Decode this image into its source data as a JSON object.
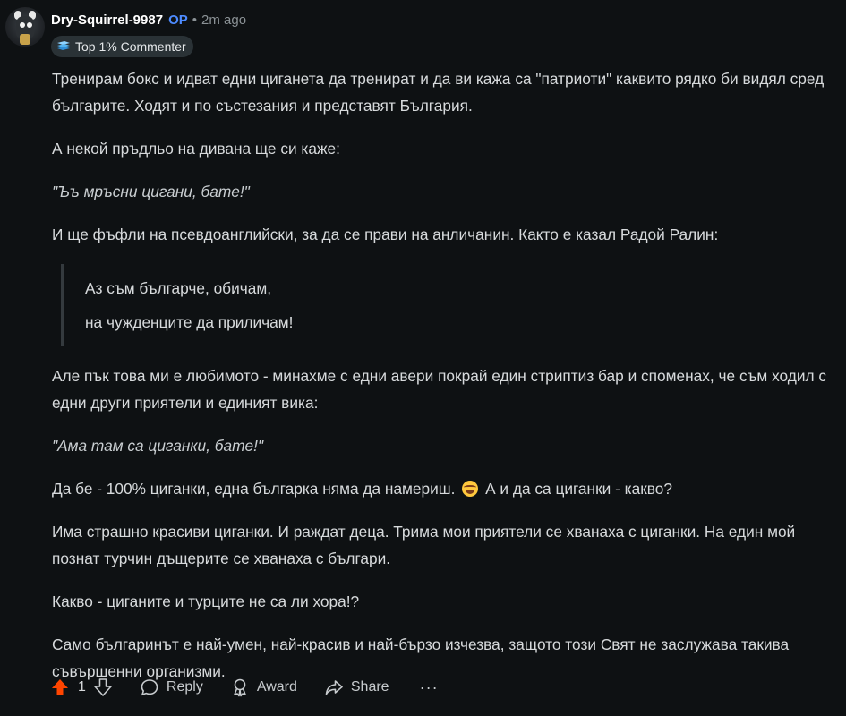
{
  "comment": {
    "author": "Dry-Squirrel-9987",
    "op_badge": "OP",
    "separator": "•",
    "time_ago": "2m ago",
    "flair": "Top 1% Commenter",
    "paragraphs": {
      "p1": "Тренирам бокс и идват едни циганета да тренират и да ви кажа са \"патриоти\" каквито рядко би видял сред българите. Ходят и по състезания и представят България.",
      "p2": "А некой пръдльо на дивана ще си каже:",
      "p3": "\"Ъъ мръсни цигани, бате!\"",
      "p4": "И ще фъфли на псевдоанглийски, за да се прави на анличанин. Както е казал Радой Ралин:",
      "quote_line1": "Аз съм българче, обичам,",
      "quote_line2": "на чужденците да приличам!",
      "p5": "Але пък това ми е любимото - минахме с едни авери покрай един стриптиз бар и споменах, че съм ходил с едни други приятели и единият вика:",
      "p6": "\"Ама там са циганки, бате!\"",
      "p7_before": "Да бе - 100% циганки, една българка няма да намериш.",
      "p7_after": "А и да са циганки - какво?",
      "p8": "Има страшно красиви циганки. И раждат деца. Трима мои приятели се хванаха с циганки. На един мой познат турчин дъщерите се хванаха с българи.",
      "p9": "Какво - циганите и турците не са ли хора!?",
      "p10": "Само българинът е най-умен, най-красив и най-бързо изчезва, защото този Свят не заслужава такива съвършенни организми."
    }
  },
  "actions": {
    "vote_count": "1",
    "reply": "Reply",
    "award": "Award",
    "share": "Share",
    "more": "···"
  },
  "colors": {
    "background": "#0e1113",
    "text": "#d7dadc",
    "op": "#4d8bff",
    "upvote": "#ff4500"
  }
}
